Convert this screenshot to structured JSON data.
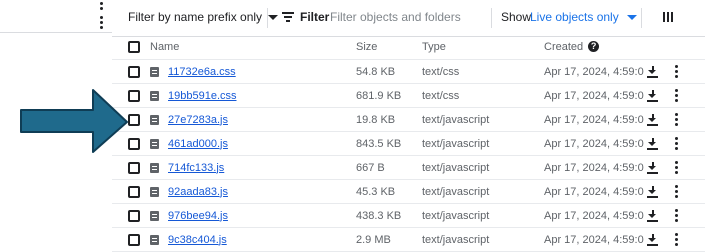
{
  "toolbar": {
    "filter_prefix_label": "Filter by name prefix only",
    "filter_label": "Filter",
    "filter_placeholder": "Filter objects and folders",
    "show_label": "Show",
    "show_value": "Live objects only"
  },
  "columns": {
    "name": "Name",
    "size": "Size",
    "type": "Type",
    "created": "Created",
    "help_glyph": "?"
  },
  "rows": [
    {
      "name": "11732e6a.css",
      "size": "54.8 KB",
      "type": "text/css",
      "created": "Apr 17, 2024, 4:59:0"
    },
    {
      "name": "19bb591e.css",
      "size": "681.9 KB",
      "type": "text/css",
      "created": "Apr 17, 2024, 4:59:0"
    },
    {
      "name": "27e7283a.js",
      "size": "19.8 KB",
      "type": "text/javascript",
      "created": "Apr 17, 2024, 4:59:0"
    },
    {
      "name": "461ad000.js",
      "size": "843.5 KB",
      "type": "text/javascript",
      "created": "Apr 17, 2024, 4:59:0"
    },
    {
      "name": "714fc133.js",
      "size": "667 B",
      "type": "text/javascript",
      "created": "Apr 17, 2024, 4:59:0"
    },
    {
      "name": "92aada83.js",
      "size": "45.3 KB",
      "type": "text/javascript",
      "created": "Apr 17, 2024, 4:59:0"
    },
    {
      "name": "976bee94.js",
      "size": "438.3 KB",
      "type": "text/javascript",
      "created": "Apr 17, 2024, 4:59:0"
    },
    {
      "name": "9c38c404.js",
      "size": "2.9 MB",
      "type": "text/javascript",
      "created": "Apr 17, 2024, 4:59:0"
    }
  ],
  "icons": {
    "file": "file-document-icon",
    "download": "download-icon",
    "more": "more-vert-icon",
    "filter": "filter-list-icon",
    "density": "column-display-icon",
    "arrow": "pointer-arrow"
  },
  "colors": {
    "link": "#1558d6",
    "accent": "#1a73e8",
    "arrow_fill": "#1f6a8c",
    "arrow_stroke": "#0f3d55"
  }
}
